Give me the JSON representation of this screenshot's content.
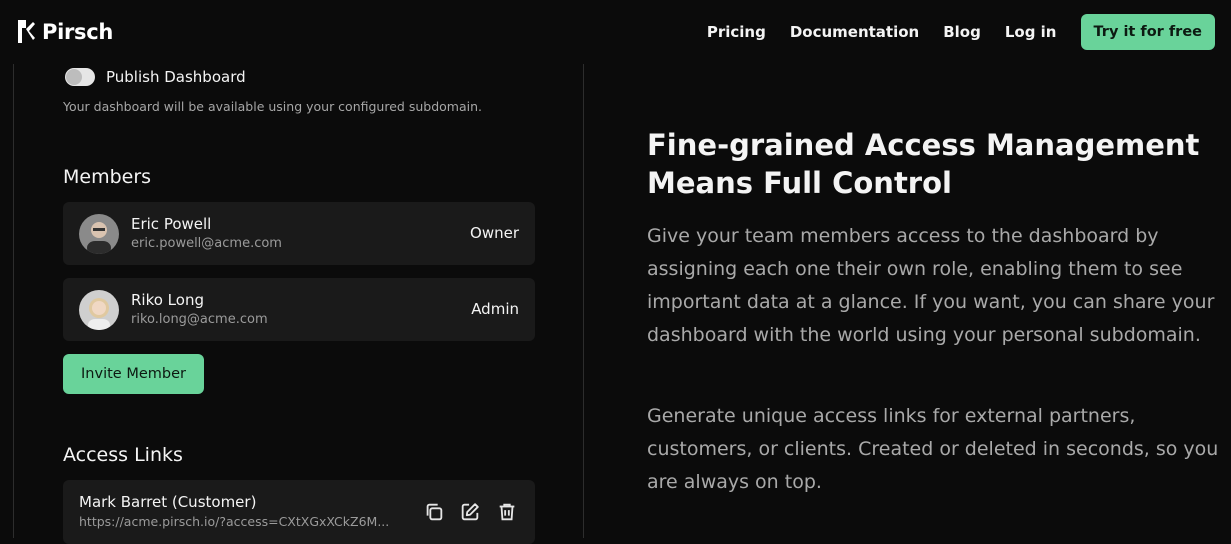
{
  "header": {
    "brand": "Pirsch",
    "nav": [
      "Pricing",
      "Documentation",
      "Blog",
      "Log in"
    ],
    "cta": "Try it for free"
  },
  "publish": {
    "label": "Publish Dashboard",
    "hint": "Your dashboard will be available using your configured subdomain.",
    "enabled": false
  },
  "members": {
    "title": "Members",
    "items": [
      {
        "name": "Eric Powell",
        "email": "eric.powell@acme.com",
        "role": "Owner"
      },
      {
        "name": "Riko Long",
        "email": "riko.long@acme.com",
        "role": "Admin"
      }
    ],
    "invite_label": "Invite Member"
  },
  "access_links": {
    "title": "Access Links",
    "items": [
      {
        "name": "Mark Barret (Customer)",
        "url": "https://acme.pirsch.io/?access=CXtXGxXCkZ6M..."
      }
    ],
    "actions": [
      "copy-icon",
      "edit-icon",
      "delete-icon"
    ]
  },
  "feature": {
    "headline": "Fine-grained Access Management Means Full Control",
    "paragraphs": [
      "Give your team members access to the dashboard by assigning each one their own role, enabling them to see important data at a glance. If you want, you can share your dashboard with the world using your personal subdomain.",
      "Generate unique access links for external partners, customers, or clients. Created or deleted in seconds, so you are always on top."
    ]
  },
  "colors": {
    "background": "#0b0b0b",
    "accent": "#69d39a",
    "card": "#1a1a1a",
    "muted_text": "#a9a9a9"
  }
}
